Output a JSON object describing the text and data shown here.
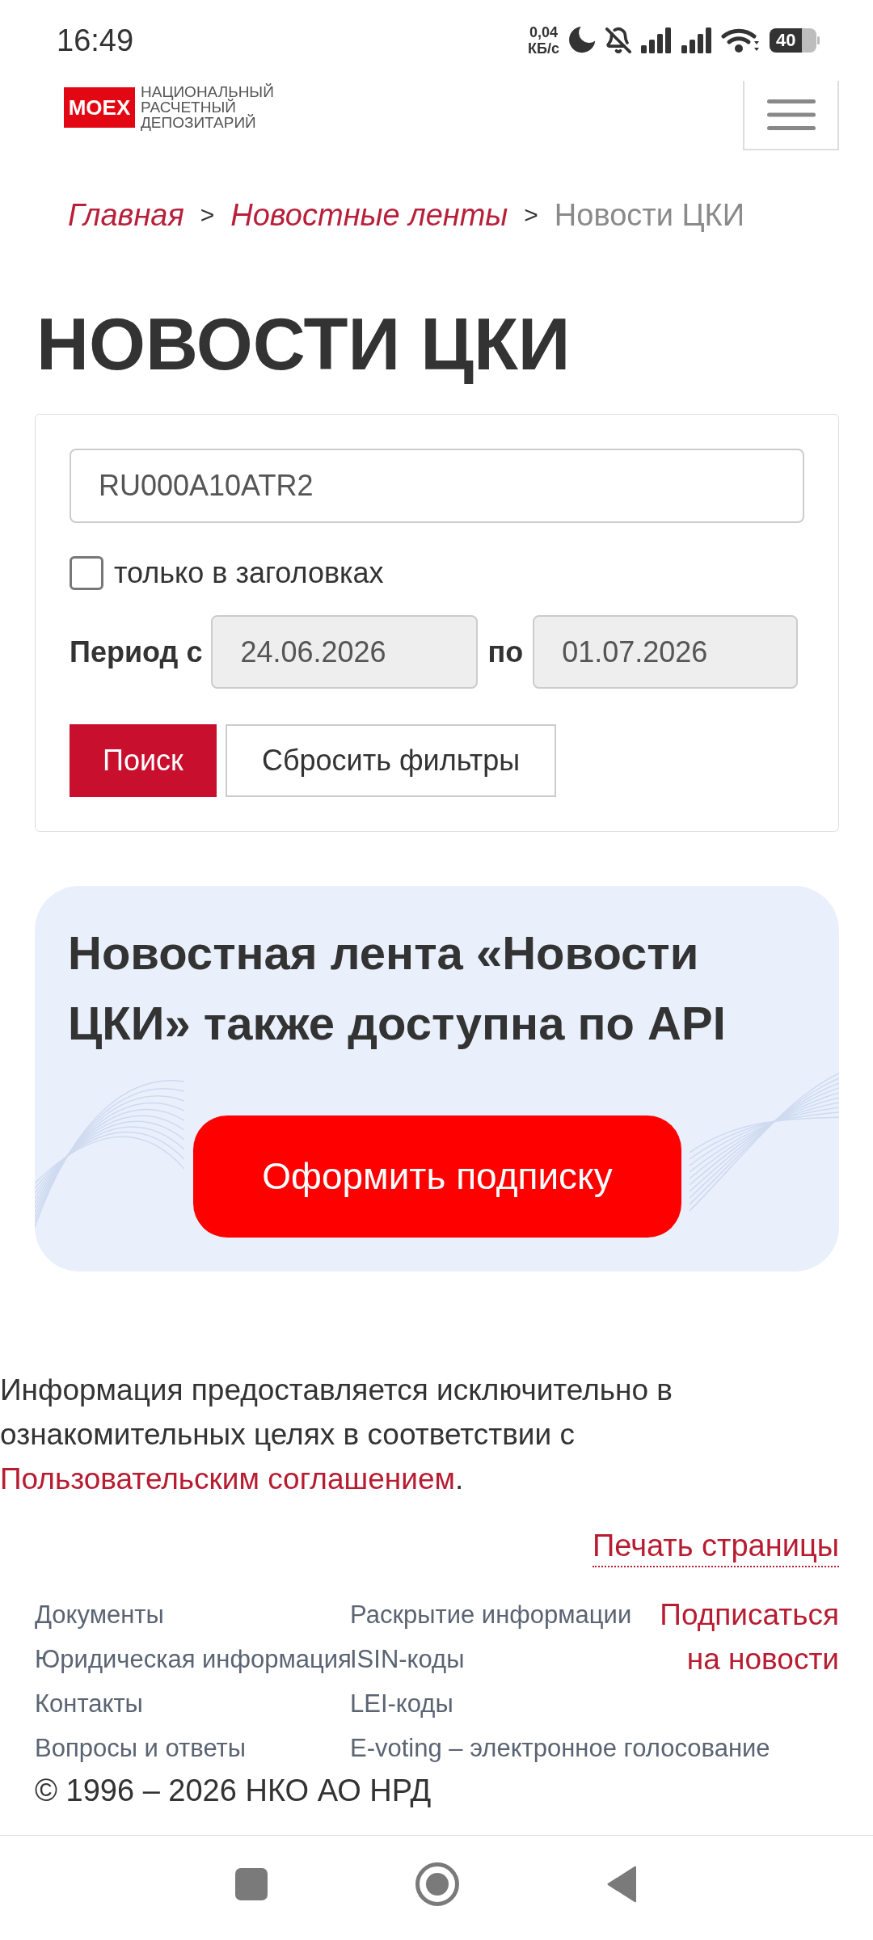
{
  "status_bar": {
    "time": "16:49",
    "network_speed": "0,04",
    "network_speed_unit": "КБ/с",
    "battery": "40"
  },
  "header": {
    "logo_mark": "MOEX",
    "logo_lines": [
      "НАЦИОНАЛЬНЫЙ",
      "РАСЧЕТНЫЙ",
      "ДЕПОЗИТАРИЙ"
    ]
  },
  "breadcrumbs": [
    {
      "kind": "link",
      "label": "Главная"
    },
    {
      "kind": "separator",
      "label": ">"
    },
    {
      "kind": "link",
      "label": "Новостные ленты"
    },
    {
      "kind": "separator",
      "label": ">"
    },
    {
      "kind": "current",
      "label": "Новости ЦКИ"
    }
  ],
  "page_title": "НОВОСТИ ЦКИ",
  "filter": {
    "query": {
      "value": "RU000A10ATR2"
    },
    "headlines_only": {
      "label": "только в заголовках",
      "checked": false
    },
    "period_label": "Период с",
    "date_from": {
      "value": "24.06.2026"
    },
    "to_label": "по",
    "date_to": {
      "value": "01.07.2026"
    },
    "buttons": [
      {
        "kind": "primary",
        "label": "Поиск"
      },
      {
        "kind": "secondary",
        "label": "Сбросить фильтры"
      }
    ]
  },
  "api_banner": {
    "heading": "Новостная лента «Новости ЦКИ» также доступна по API",
    "button": "Оформить подписку"
  },
  "disclaimer": {
    "text": "Информация предоставляется исключительно в ознакомительных целях в соответствии с",
    "link": "Пользовательским соглашением",
    "end": "."
  },
  "print_link": "Печать страницы",
  "footer": {
    "columns": [
      [
        "Документы",
        "Юридическая информация",
        "Контакты",
        "Вопросы и ответы"
      ],
      [
        "Раскрытие информации",
        "ISIN-коды",
        "LEI-коды",
        "E-voting – электронное голосование"
      ]
    ],
    "subscribe": "Подписаться на новости",
    "copyright": "© 1996 – 2026 НКО АО НРД"
  }
}
